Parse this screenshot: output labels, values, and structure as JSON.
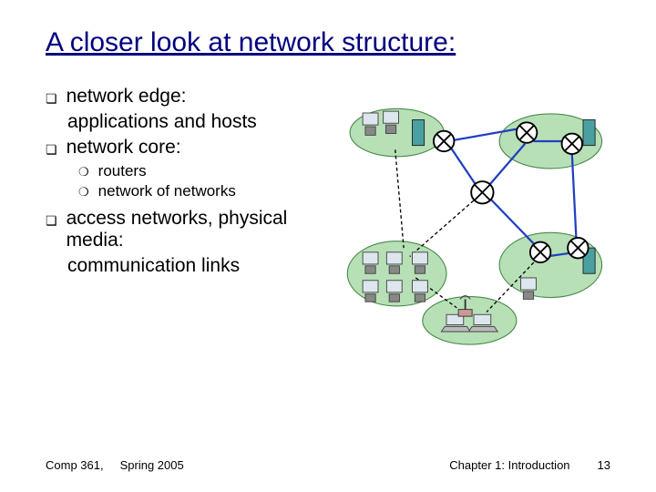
{
  "title": "A closer look at network structure:",
  "bullets": {
    "b1": {
      "label": "network edge:",
      "sub": "applications and hosts"
    },
    "b2": {
      "label": "network core:",
      "subitems": [
        "routers",
        "network of networks"
      ]
    },
    "b3": {
      "label": "access networks, physical media:",
      "sub": "communication links"
    }
  },
  "footer": {
    "course": "Comp 361,",
    "term": "Spring 2005",
    "chapter": "Chapter 1: Introduction",
    "page": "13"
  }
}
